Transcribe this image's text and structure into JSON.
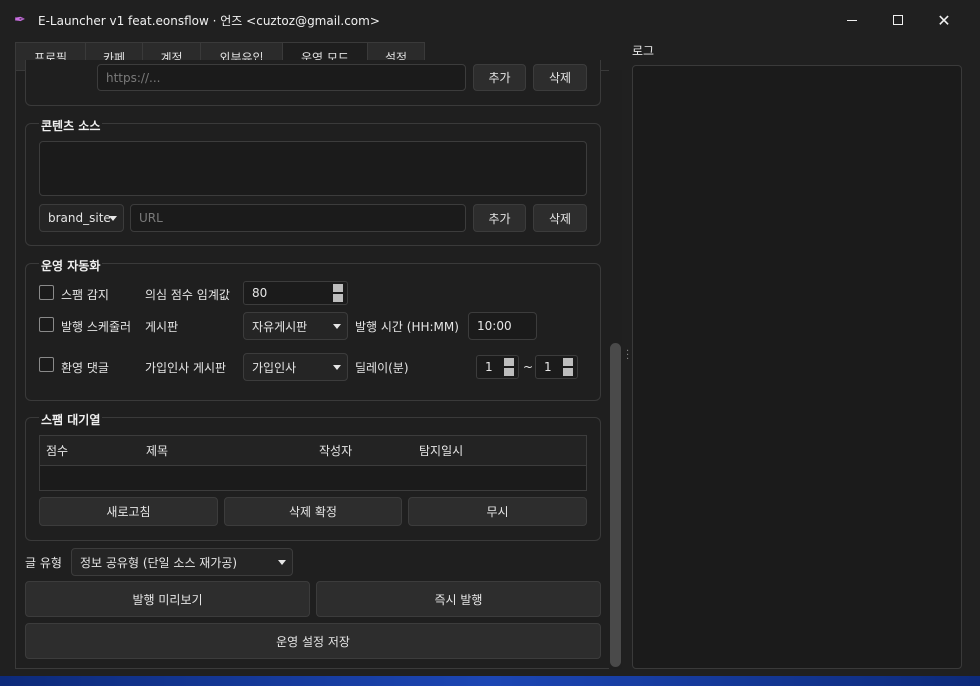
{
  "window": {
    "title": "E-Launcher v1 feat.eonsflow  ·  언즈 <cuztoz@gmail.com>"
  },
  "tabs": [
    {
      "label": "프로필"
    },
    {
      "label": "카페"
    },
    {
      "label": "계정"
    },
    {
      "label": "외부유입"
    },
    {
      "label": "운영 모드"
    },
    {
      "label": "설정"
    }
  ],
  "top_section": {
    "url_placeholder": "https://...",
    "add_label": "추가",
    "delete_label": "삭제"
  },
  "content_source": {
    "title": "콘텐츠 소스",
    "source_type": "brand_site",
    "url_placeholder": "URL",
    "add_label": "추가",
    "delete_label": "삭제"
  },
  "automation": {
    "title": "운영 자동화",
    "spam_detect_label": "스팸 감지",
    "threshold_label": "의심 점수 임계값",
    "threshold_value": "80",
    "scheduler_label": "발행 스케줄러",
    "board_label": "게시판",
    "board_value": "자유게시판",
    "time_label": "발행 시간 (HH:MM)",
    "time_value": "10:00",
    "welcome_label": "환영 댓글",
    "greet_board_label": "가입인사 게시판",
    "greet_board_value": "가입인사",
    "delay_label": "딜레이(분)",
    "delay_min": "1",
    "delay_tilde": "~",
    "delay_max": "1"
  },
  "spam_queue": {
    "title": "스팸 대기열",
    "columns": [
      "점수",
      "제목",
      "작성자",
      "탐지일시"
    ],
    "refresh_label": "새로고침",
    "confirm_delete_label": "삭제 확정",
    "ignore_label": "무시"
  },
  "post_type": {
    "label": "글 유형",
    "value": "정보 공유형 (단일 소스 재가공)"
  },
  "actions": {
    "preview_label": "발행 미리보기",
    "publish_label": "즉시 발행",
    "save_label": "운영 설정 저장"
  },
  "log": {
    "label": "로그"
  }
}
